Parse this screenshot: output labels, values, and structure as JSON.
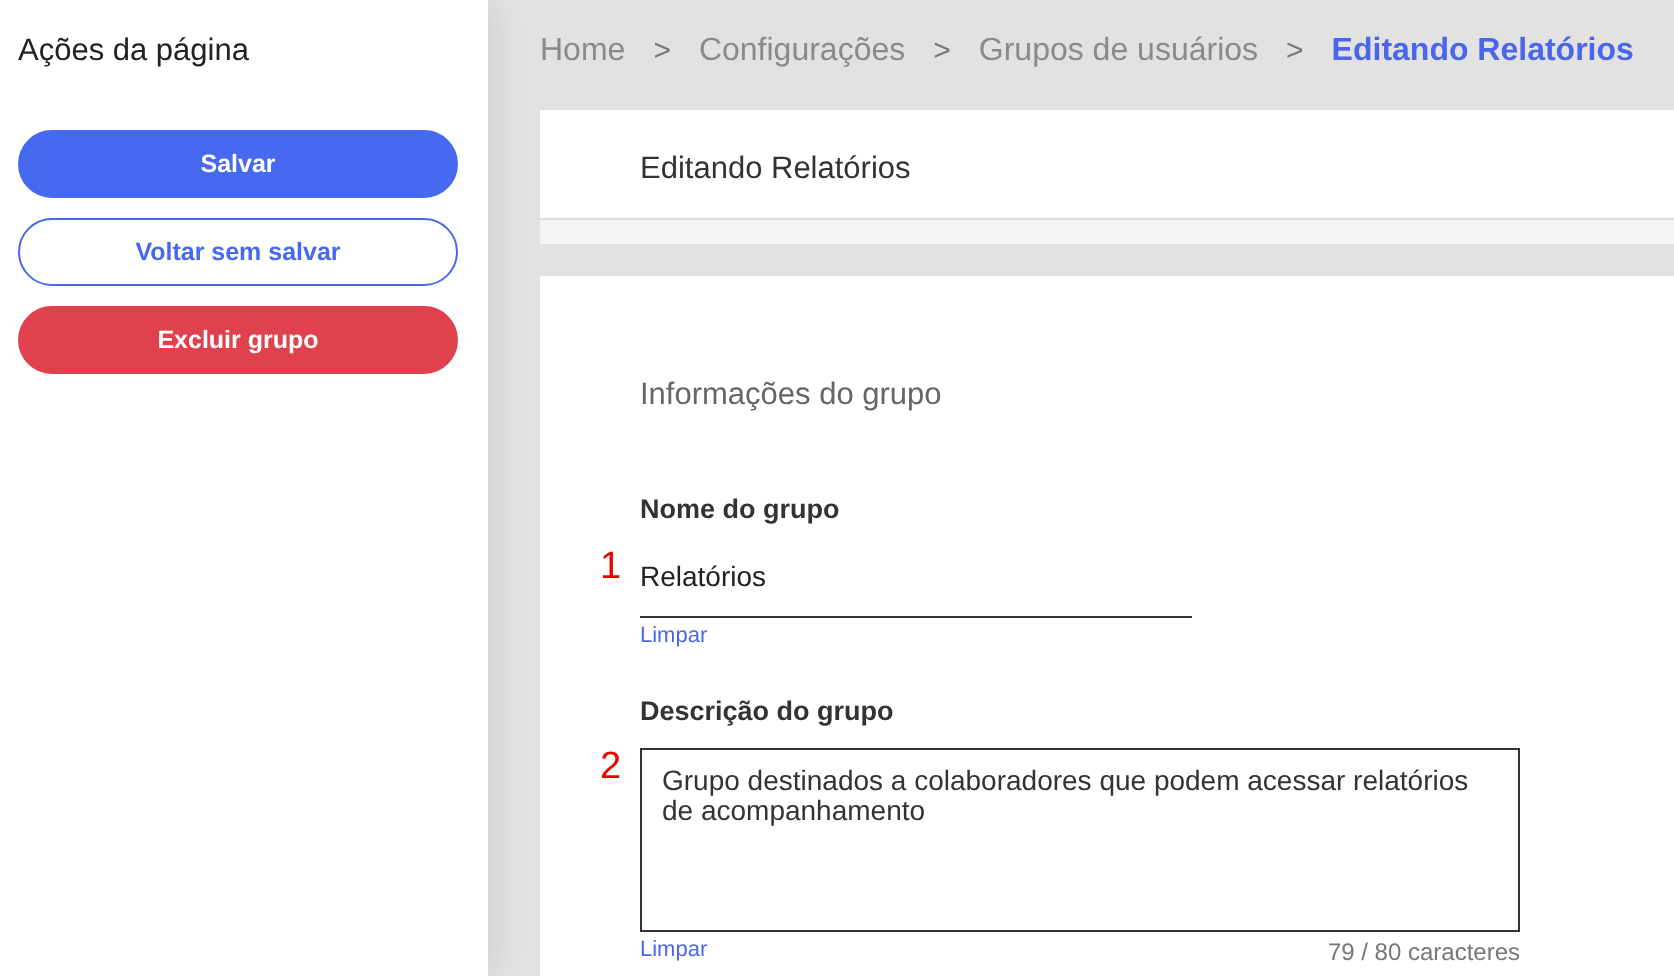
{
  "sidebar": {
    "title": "Ações da página",
    "buttons": [
      {
        "label": "Salvar",
        "kind": "primary"
      },
      {
        "label": "Voltar sem salvar",
        "kind": "outline"
      },
      {
        "label": "Excluir grupo",
        "kind": "danger"
      }
    ]
  },
  "breadcrumb": [
    {
      "label": "Home",
      "selected": false
    },
    {
      "label": "Configurações",
      "selected": false
    },
    {
      "label": "Grupos de usuários",
      "selected": false
    },
    {
      "label": "Editando Relatórios",
      "selected": true
    }
  ],
  "breadcrumb_separator": ">",
  "header": {
    "title": "Editando Relatórios"
  },
  "form": {
    "section_title": "Informações do grupo",
    "fields": [
      {
        "kind": "input",
        "label": "Nome do grupo",
        "marker": "1",
        "value": "Relatórios",
        "clear": "Limpar"
      },
      {
        "kind": "textarea",
        "label": "Descrição do grupo",
        "marker": "2",
        "value": "Grupo destinados a colaboradores que podem acessar relatórios de acompanhamento",
        "clear": "Limpar",
        "counter": "79 / 80 caracteres"
      }
    ]
  }
}
